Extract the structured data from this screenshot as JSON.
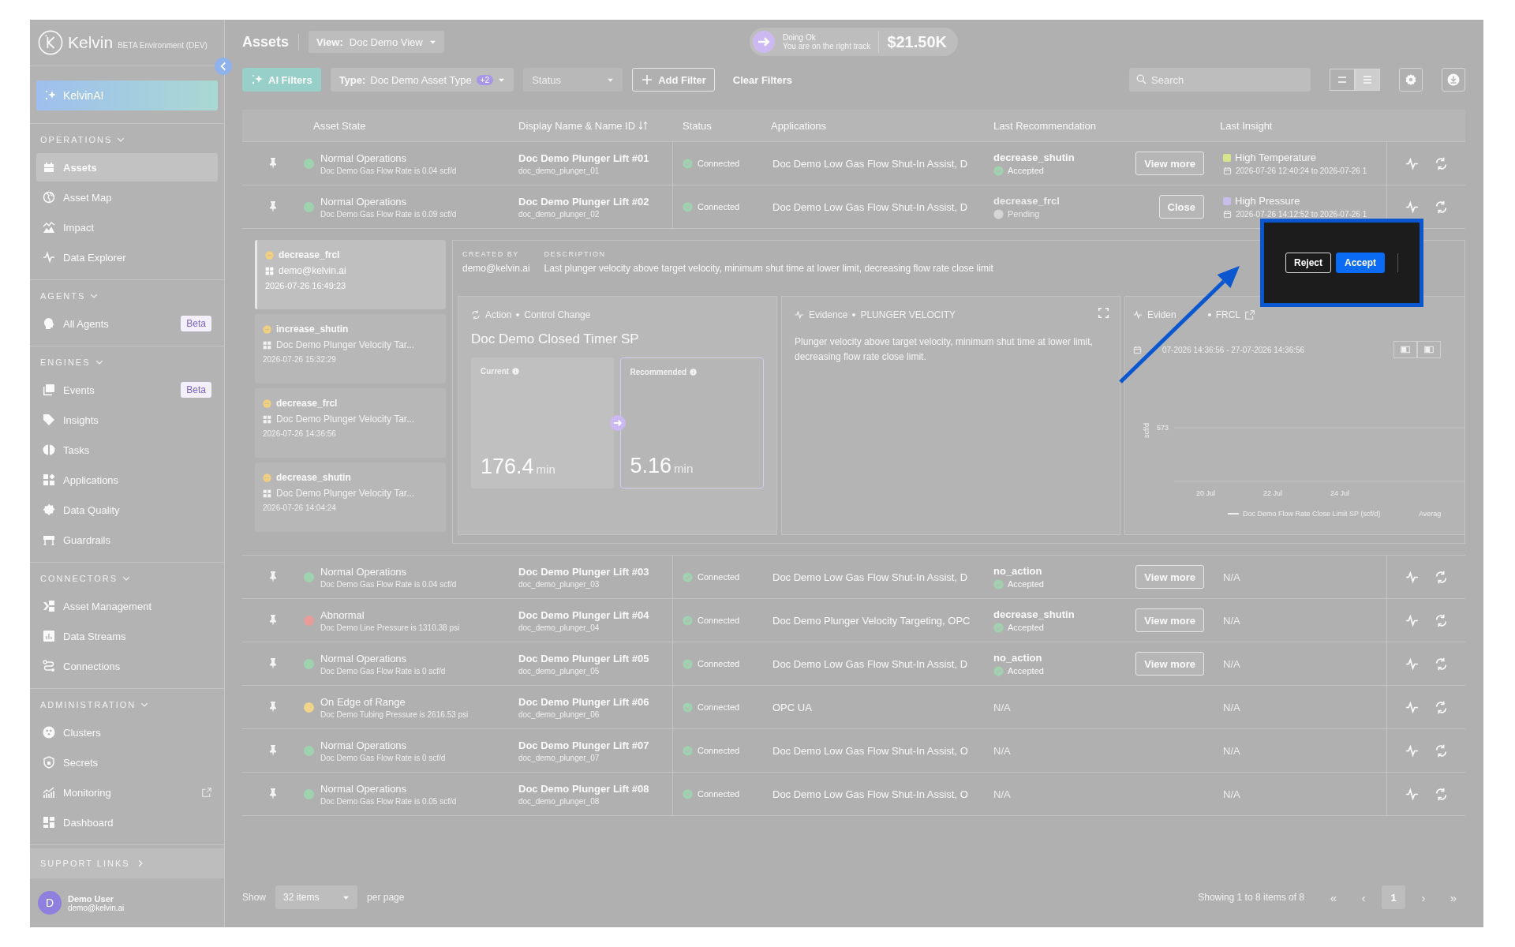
{
  "sidebar": {
    "brand": "Kelvin",
    "environment": "BETA Environment (DEV)",
    "ai_button": "KelvinAI",
    "sections": [
      {
        "title": "OPERATIONS",
        "items": [
          {
            "label": "Assets",
            "selected": true,
            "external": false
          },
          {
            "label": "Asset Map",
            "selected": false,
            "external": false
          },
          {
            "label": "Impact",
            "selected": false,
            "external": false
          },
          {
            "label": "Data Explorer",
            "selected": false,
            "external": false
          }
        ]
      },
      {
        "title": "AGENTS",
        "items": [
          {
            "label": "All Agents",
            "selected": false,
            "external": false,
            "badge": "Beta"
          }
        ]
      },
      {
        "title": "ENGINES",
        "items": [
          {
            "label": "Events",
            "selected": false,
            "external": false,
            "badge": "Beta"
          },
          {
            "label": "Insights",
            "selected": false,
            "external": false
          },
          {
            "label": "Tasks",
            "selected": false,
            "external": false
          },
          {
            "label": "Applications",
            "selected": false,
            "external": false
          },
          {
            "label": "Data Quality",
            "selected": false,
            "external": false
          },
          {
            "label": "Guardrails",
            "selected": false,
            "external": false
          }
        ]
      },
      {
        "title": "CONNECTORS",
        "items": [
          {
            "label": "Asset Management",
            "selected": false,
            "external": false
          },
          {
            "label": "Data Streams",
            "selected": false,
            "external": false
          },
          {
            "label": "Connections",
            "selected": false,
            "external": false
          }
        ]
      },
      {
        "title": "ADMINISTRATION",
        "items": [
          {
            "label": "Clusters",
            "selected": false,
            "external": false
          },
          {
            "label": "Secrets",
            "selected": false,
            "external": false
          },
          {
            "label": "Monitoring",
            "selected": false,
            "external": true
          },
          {
            "label": "Dashboard",
            "selected": false,
            "external": false
          }
        ]
      }
    ],
    "support_links": "SUPPORT LINKS",
    "user": {
      "initial": "D",
      "name": "Demo User",
      "email": "demo@kelvin.ai"
    }
  },
  "header": {
    "title": "Assets",
    "view": "**View:**Doc Demo View",
    "status": {
      "title": "Doing Ok",
      "subtitle": "You are on the right track",
      "amount": "$21.50K"
    }
  },
  "filters": {
    "ai_filters": "AI Filters",
    "type_filter": "**Type:**Doc Demo Asset Type",
    "type_extra": "+2",
    "status_placeholder": "Status",
    "add_filter": "Add Filter",
    "clear_filters": "Clear Filters",
    "search_placeholder": "Search",
    "layouts": [
      {
        "kind": "compact",
        "selected": false
      },
      {
        "kind": "list",
        "selected": true
      }
    ]
  },
  "table": {
    "columns": [
      {
        "label": "Asset State",
        "sorted": false
      },
      {
        "label": "Display Name & Name ID",
        "sorted": true
      },
      {
        "label": "Status",
        "sorted": false
      },
      {
        "label": "Applications",
        "sorted": false
      },
      {
        "label": "Last Recommendation",
        "sorted": false
      },
      {
        "label": "Last Insight",
        "sorted": false
      }
    ],
    "rows": [
      {
        "state": "Normal Operations",
        "state_detail": "Doc Demo Gas Flow Rate is 0.04 scf/d",
        "color": "#9fd3b0",
        "name": "Doc Demo Plunger Lift #01",
        "name_id": "doc_demo_plunger_01",
        "status": "Connected",
        "applications": "Doc Demo Low Gas Flow Shut-In Assist, D",
        "recommendation": {
          "name": "decrease_shutin",
          "status": "Accepted",
          "kind": "accepted"
        },
        "action": "View more",
        "insight": {
          "name": "High Temperature",
          "color": "#d6e68c",
          "range": "2026-07-26 12:40:24 to 2026-07-26 1"
        }
      },
      {
        "state": "Normal Operations",
        "state_detail": "Doc Demo Gas Flow Rate is 0.09 scf/d",
        "color": "#9fd3b0",
        "name": "Doc Demo Plunger Lift #02",
        "name_id": "doc_demo_plunger_02",
        "status": "Connected",
        "applications": "Doc Demo Low Gas Flow Shut-In Assist, D",
        "recommendation": {
          "name": "decrease_frcl",
          "status": "Pending",
          "kind": "pending"
        },
        "action": "Close",
        "insight": {
          "name": "High Pressure",
          "color": "#c9bdec",
          "range": "2026-07-26 14:12:52 to 2026-07-26 1"
        },
        "detail": {
          "recommendations": [
            {
              "name": "decrease_frcl",
              "source": "demo@kelvin.ai",
              "time": "2026-07-26 16:49:23",
              "selected": true
            },
            {
              "name": "increase_shutin",
              "source": "Doc Demo Plunger Velocity Tar...",
              "time": "2026-07-26 15:32:29",
              "selected": false
            },
            {
              "name": "decrease_frcl",
              "source": "Doc Demo Plunger Velocity Tar...",
              "time": "2026-07-26 14:36:56",
              "selected": false
            },
            {
              "name": "decrease_shutin",
              "source": "Doc Demo Plunger Velocity Tar...",
              "time": "2026-07-26 14:04:24",
              "selected": false
            }
          ],
          "created_by_label": "CREATED BY",
          "created_by": "demo@kelvin.ai",
          "description_label": "DESCRIPTION",
          "description": "Last plunger velocity above target velocity, minimum shut time at lower limit, decreasing flow rate close limit",
          "action": {
            "label": "Action",
            "type": "Control Change",
            "title": "Doc Demo Closed Timer SP",
            "current": {
              "label": "Current",
              "value": "176.4",
              "unit": "min"
            },
            "recommended": {
              "label": "Recommended",
              "value": "5.16",
              "unit": "min"
            }
          },
          "evidence": [
            {
              "kind": "text",
              "label": "Evidence",
              "name": "PLUNGER VELOCITY",
              "text": "Plunger velocity above target velocity, minimum shut time at lower limit, decreasing flow rate close limit."
            },
            {
              "kind": "chart",
              "label": "Eviden",
              "name": "FRCL",
              "range": "07-2026 14:36:56 - 27-07-2026 14:36:56",
              "y_label": "scf/d",
              "y_tick": "573",
              "x_ticks": [
                "20 Jul",
                "22 Jul",
                "24 Jul"
              ],
              "legend": "Doc Demo Flow Rate Close Limit SP (scf/d)",
              "legend_extra": "Averag"
            }
          ]
        }
      },
      {
        "state": "Normal Operations",
        "state_detail": "Doc Demo Gas Flow Rate is 0.04 scf/d",
        "color": "#9fd3b0",
        "name": "Doc Demo Plunger Lift #03",
        "name_id": "doc_demo_plunger_03",
        "status": "Connected",
        "applications": "Doc Demo Low Gas Flow Shut-In Assist, D",
        "recommendation": {
          "name": "no_action",
          "status": "Accepted",
          "kind": "accepted"
        },
        "action": "View more",
        "insight": "N/A"
      },
      {
        "state": "Abnormal",
        "state_detail": "Doc Demo Line Pressure is 1310.38 psi",
        "color": "#e79c99",
        "name": "Doc Demo Plunger Lift #04",
        "name_id": "doc_demo_plunger_04",
        "status": "Connected",
        "applications": "Doc Demo Plunger Velocity Targeting, OPC",
        "recommendation": {
          "name": "decrease_shutin",
          "status": "Accepted",
          "kind": "accepted"
        },
        "action": "View more",
        "insight": "N/A"
      },
      {
        "state": "Normal Operations",
        "state_detail": "Doc Demo Gas Flow Rate is 0 scf/d",
        "color": "#9fd3b0",
        "name": "Doc Demo Plunger Lift #05",
        "name_id": "doc_demo_plunger_05",
        "status": "Connected",
        "applications": "Doc Demo Low Gas Flow Shut-In Assist, D",
        "recommendation": {
          "name": "no_action",
          "status": "Accepted",
          "kind": "accepted"
        },
        "action": "View more",
        "insight": "N/A"
      },
      {
        "state": "On Edge of Range",
        "state_detail": "Doc Demo Tubing Pressure is 2616.53 psi",
        "color": "#f1d48c",
        "name": "Doc Demo Plunger Lift #06",
        "name_id": "doc_demo_plunger_06",
        "status": "Connected",
        "applications": "OPC UA",
        "recommendation": "N/A",
        "insight": "N/A"
      },
      {
        "state": "Normal Operations",
        "state_detail": "Doc Demo Gas Flow Rate is 0 scf/d",
        "color": "#9fd3b0",
        "name": "Doc Demo Plunger Lift #07",
        "name_id": "doc_demo_plunger_07",
        "status": "Connected",
        "applications": "Doc Demo Low Gas Flow Shut-In Assist, O",
        "recommendation": "N/A",
        "insight": "N/A"
      },
      {
        "state": "Normal Operations",
        "state_detail": "Doc Demo Gas Flow Rate is 0.05 scf/d",
        "color": "#9fd3b0",
        "name": "Doc Demo Plunger Lift #08",
        "name_id": "doc_demo_plunger_08",
        "status": "Connected",
        "applications": "Doc Demo Low Gas Flow Shut-In Assist, O",
        "recommendation": "N/A",
        "insight": "N/A"
      }
    ]
  },
  "spotlight": {
    "buttons": [
      {
        "label": "Reject",
        "kind": "secondary"
      },
      {
        "label": "Accept",
        "kind": "primary"
      }
    ]
  },
  "footer": {
    "show_label": "Show",
    "page_size": "32 items",
    "per_page": "per page",
    "summary": "Showing 1 to 8 items of 8",
    "first": "«",
    "prev": "‹",
    "pages": [
      {
        "label": "1",
        "selected": true
      }
    ],
    "next": "›",
    "last": "»"
  }
}
